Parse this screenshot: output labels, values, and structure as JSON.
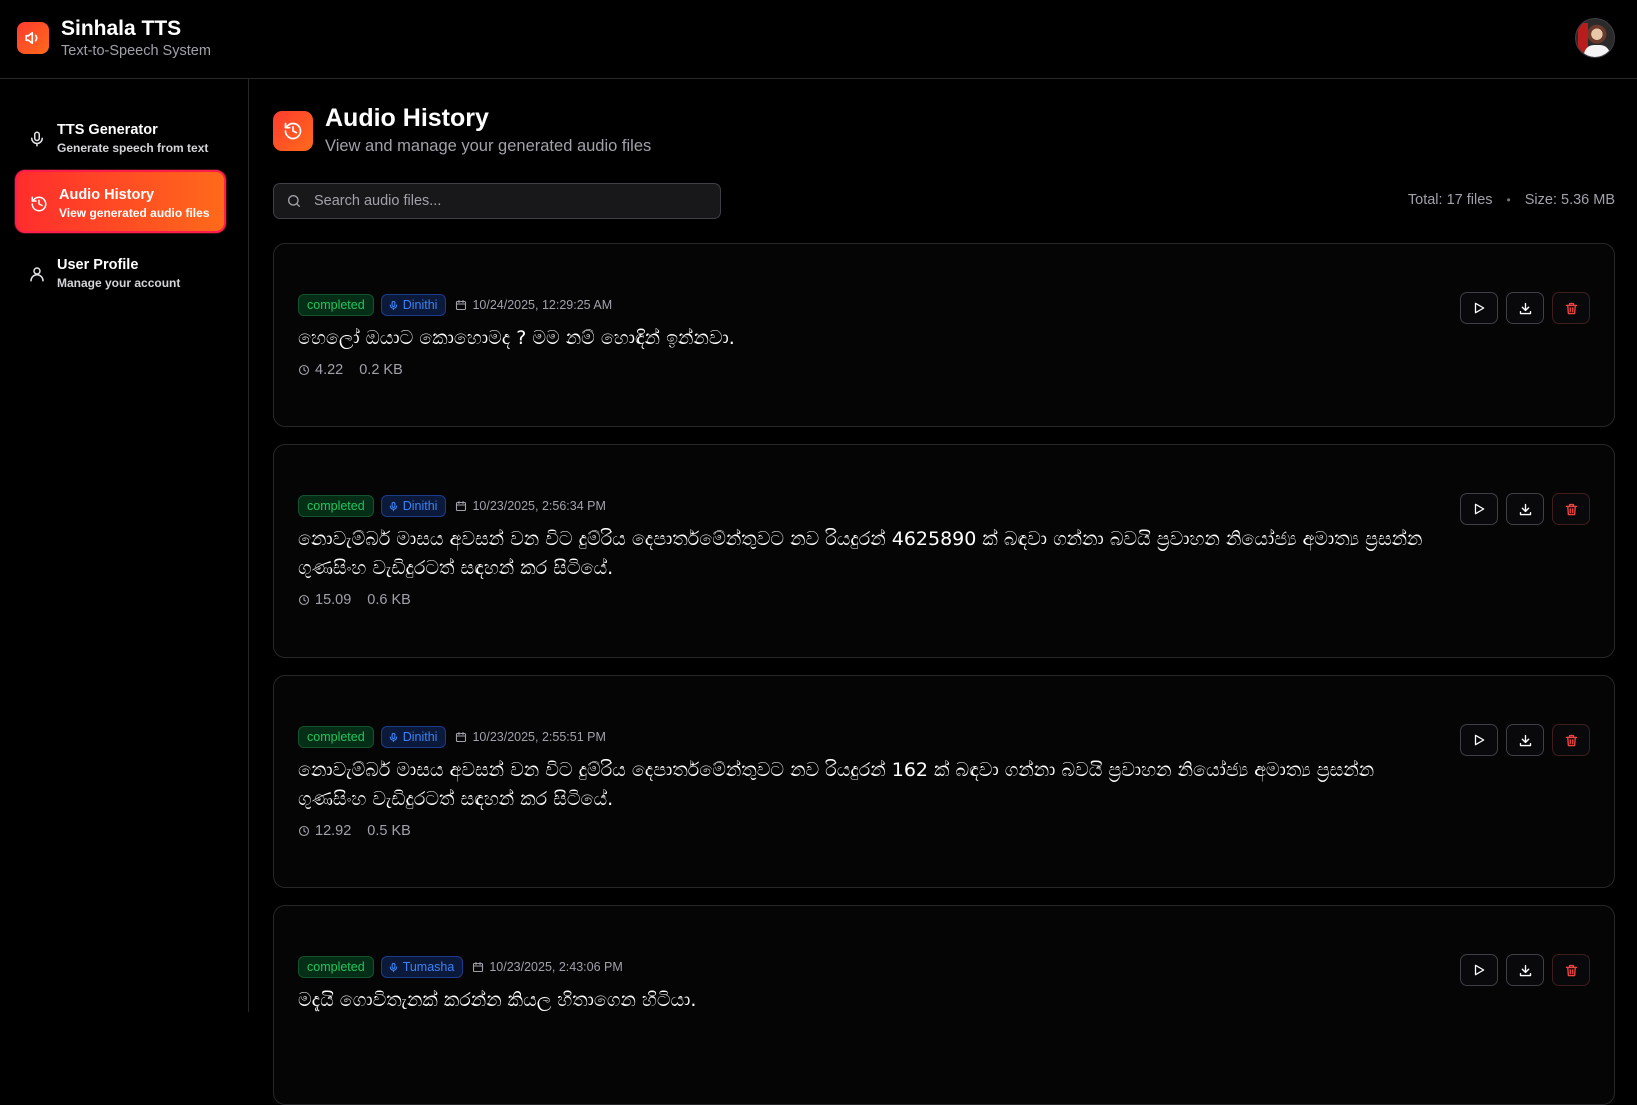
{
  "app": {
    "title": "Sinhala TTS",
    "subtitle": "Text-to-Speech System",
    "accent": "#ff4b2b"
  },
  "sidebar": {
    "items": [
      {
        "label": "TTS Generator",
        "desc": "Generate speech from text",
        "icon": "microphone-icon",
        "active": false
      },
      {
        "label": "Audio History",
        "desc": "View generated audio files",
        "icon": "history-icon",
        "active": true
      },
      {
        "label": "User Profile",
        "desc": "Manage your account",
        "icon": "user-icon",
        "active": false
      }
    ]
  },
  "page": {
    "title": "Audio History",
    "subtitle": "View and manage your generated audio files"
  },
  "search": {
    "placeholder": "Search audio files...",
    "value": ""
  },
  "stats": {
    "total": "Total: 17 files",
    "separator": "•",
    "size": "Size: 5.36 MB"
  },
  "records": [
    {
      "status": "completed",
      "voice": "Dinithi",
      "date": "10/24/2025, 12:29:25 AM",
      "text": "හෙලෝ ඔයාට කොහොමද ? මම නම් හොඳින් ඉන්නවා.",
      "duration": "4.22",
      "size": "0.2 KB"
    },
    {
      "status": "completed",
      "voice": "Dinithi",
      "date": "10/23/2025, 2:56:34 PM",
      "text": "නොවැම්බර් මාසය අවසන් වන විට දුම්රිය දෙපාර්තමේන්තුවට නව රියදුරන් 4625890 ක් බඳවා ගන්නා බවයි ප්‍රවාහන නියෝජ්‍ය අමාත්‍ය ප්‍රසන්න ගුණසිංහ වැඩිදුරටත් සඳහන් කර සිටියේ.",
      "duration": "15.09",
      "size": "0.6 KB"
    },
    {
      "status": "completed",
      "voice": "Dinithi",
      "date": "10/23/2025, 2:55:51 PM",
      "text": "නොවැම්බර් මාසය අවසන් වන විට දුම්රිය දෙපාර්තමේන්තුවට නව රියදුරන් 162 ක් බඳවා ගන්නා බවයි ප්‍රවාහන නියෝජ්‍ය අමාත්‍ය ප්‍රසන්න ගුණසිංහ වැඩිදුරටත් සඳහන් කර සිටියේ.",
      "duration": "12.92",
      "size": "0.5 KB"
    },
    {
      "status": "completed",
      "voice": "Tumasha",
      "date": "10/23/2025, 2:43:06 PM",
      "text": "මදැයි ගොවිතැනක් කරන්න කියල හිතාගෙන හිටියා.",
      "duration": "",
      "size": ""
    }
  ],
  "colors": {
    "status_green": "#22c55e",
    "voice_blue": "#3b82f6",
    "delete_red": "#ef4444"
  }
}
